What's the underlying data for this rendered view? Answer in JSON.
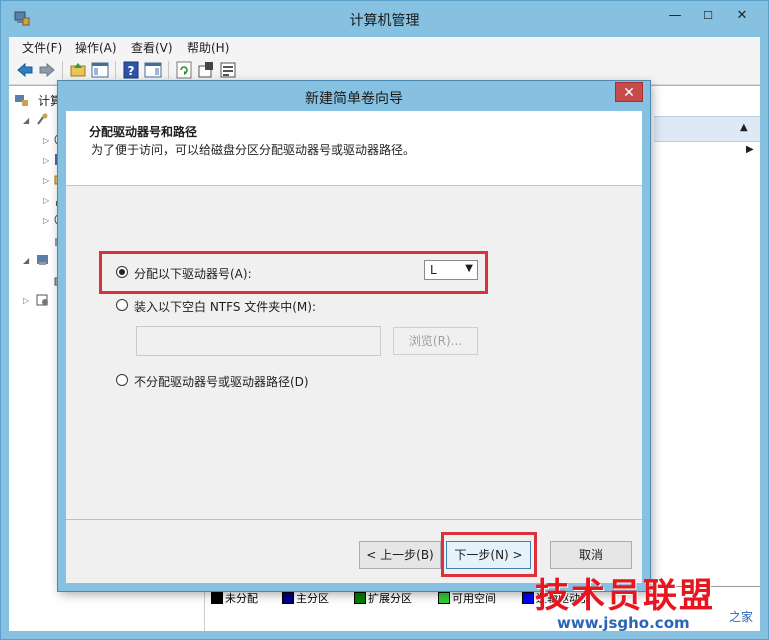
{
  "window": {
    "title": "计算机管理",
    "controls": {
      "minimize": "—",
      "maximize": "☐",
      "close": "✕"
    }
  },
  "menu": {
    "items": [
      "文件(F)",
      "操作(A)",
      "查看(V)",
      "帮助(H)"
    ]
  },
  "tree": {
    "root_label": "计算"
  },
  "legend": {
    "items": [
      {
        "label": "未分配",
        "color": "#000000"
      },
      {
        "label": "主分区",
        "color": "#000080"
      },
      {
        "label": "扩展分区",
        "color": "#008000"
      },
      {
        "label": "可用空间",
        "color": "#33cc33"
      },
      {
        "label": "逻辑驱动器",
        "color": "#0000ff"
      }
    ]
  },
  "wizard": {
    "title": "新建简单卷向导",
    "close": "✕",
    "header_title": "分配驱动器号和路径",
    "header_subtitle": "为了便于访问，可以给磁盘分区分配驱动器号或驱动器路径。",
    "options": {
      "assign_letter": "分配以下驱动器号(A):",
      "mount_folder": "装入以下空白 NTFS 文件夹中(M):",
      "no_assign": "不分配驱动器号或驱动器路径(D)"
    },
    "selected_option": "assign_letter",
    "drive_letter": "L",
    "browse_label": "浏览(R)...",
    "buttons": {
      "back": "< 上一步(B)",
      "next": "下一步(N) >",
      "cancel": "取消"
    },
    "highlight_color": "#d9323c"
  },
  "watermark": {
    "brand": "技术员联盟",
    "url": "www.jsgho.com",
    "side": "之家"
  }
}
